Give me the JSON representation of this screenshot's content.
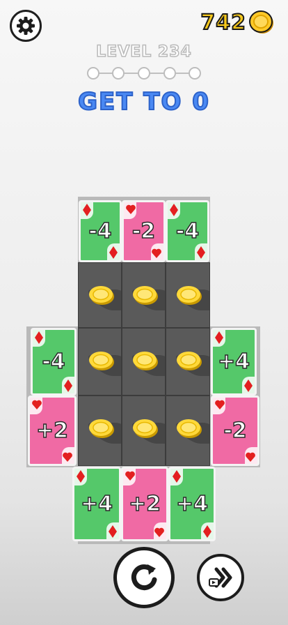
{
  "header": {
    "coin_count": "742",
    "level_label": "LEVEL 234",
    "goal_text": "GET TO 0",
    "progress": {
      "total_steps": 5,
      "completed_steps": 0
    }
  },
  "board": {
    "top_row": [
      {
        "value": "-4",
        "color": "green",
        "suit": "diamond"
      },
      {
        "value": "-2",
        "color": "pink",
        "suit": "heart"
      },
      {
        "value": "-4",
        "color": "green",
        "suit": "diamond"
      }
    ],
    "left_col": [
      {
        "value": "-4",
        "color": "green",
        "suit": "diamond"
      },
      {
        "value": "+2",
        "color": "pink",
        "suit": "heart"
      }
    ],
    "right_col": [
      {
        "value": "+4",
        "color": "green",
        "suit": "diamond"
      },
      {
        "value": "-2",
        "color": "pink",
        "suit": "heart"
      }
    ],
    "bottom_row": [
      {
        "value": "+4",
        "color": "green",
        "suit": "diamond"
      },
      {
        "value": "+2",
        "color": "pink",
        "suit": "heart"
      },
      {
        "value": "+4",
        "color": "green",
        "suit": "diamond"
      }
    ],
    "coin_tiles": 9
  },
  "colors": {
    "green_card": "#55c86a",
    "pink_card": "#f06aa4",
    "goal_blue": "#4a89f3",
    "coin_gold": "#f6c81c",
    "tile_grey": "#5a5a5a"
  },
  "icons": {
    "settings": "gear-icon",
    "coin": "coin-icon",
    "restart": "restart-icon",
    "skip": "skip-icon"
  }
}
